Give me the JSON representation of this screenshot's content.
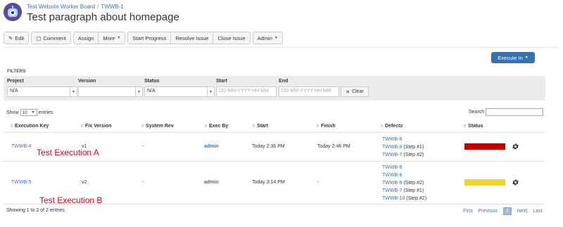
{
  "header": {
    "breadcrumb_project": "Test Website Worker Board",
    "breadcrumb_separator": "/",
    "breadcrumb_issue": "TWWB-1",
    "title": "Test paragraph about homepage"
  },
  "toolbar": {
    "edit": "Edit",
    "comment": "Comment",
    "assign": "Assign",
    "more": "More",
    "start_progress": "Start Progress",
    "resolve_issue": "Resolve Issue",
    "close_issue": "Close Issue",
    "admin": "Admin"
  },
  "execute_button": "Execute In",
  "filters": {
    "heading": "FILTERS",
    "project_label": "Project",
    "project_value": "N/A",
    "version_label": "Version",
    "version_value": "",
    "status_label": "Status",
    "status_value": "N/A",
    "start_label": "Start",
    "start_placeholder": "DD-MM-YYYY HH:MM",
    "end_label": "End",
    "end_placeholder": "DD-MM-YYYY HH:MM",
    "clear": "Clear"
  },
  "table_controls": {
    "show": "Show",
    "show_value": "10",
    "entries": "entries",
    "search": "Search"
  },
  "columns": {
    "execution_key": "Execution Key",
    "fix_version": "Fix Version",
    "system_rev": "System Rev",
    "exec_by": "Exec By",
    "start": "Start",
    "finish": "Finish",
    "defects": "Defects",
    "status": "Status"
  },
  "rows": [
    {
      "key": "TWWB-4",
      "fix_version": "v1",
      "system_rev": "-",
      "exec_by": "admin",
      "start": "Today 2:36 PM",
      "finish": "Today 2:46 PM",
      "defects": [
        {
          "key": "TWWB-6",
          "note": ""
        },
        {
          "key": "TWWB-8",
          "note": "(Step #1)"
        },
        {
          "key": "TWWB-7",
          "note": "(Step #2)"
        }
      ],
      "status_color": "#c00000",
      "annotation": "Test Execution A"
    },
    {
      "key": "TWWB-5",
      "fix_version": "v2",
      "system_rev": "-",
      "exec_by": "admin",
      "start": "Today 3:14 PM",
      "finish": "-",
      "defects": [
        {
          "key": "TWWB-6",
          "note": ""
        },
        {
          "key": "TWWB-8",
          "note": ""
        },
        {
          "key": "TWWB-9",
          "note": "(Step #2)"
        },
        {
          "key": "TWWB-7",
          "note": "(Step #1)"
        },
        {
          "key": "TWWB-10",
          "note": "(Step #2)"
        }
      ],
      "status_color": "#f0d42a",
      "annotation": "Test Execution B"
    }
  ],
  "footer": {
    "info": "Showing 1 to 2 of 2 entries",
    "first": "First",
    "previous": "Previous",
    "page": "1",
    "next": "Next",
    "last": "Last"
  }
}
